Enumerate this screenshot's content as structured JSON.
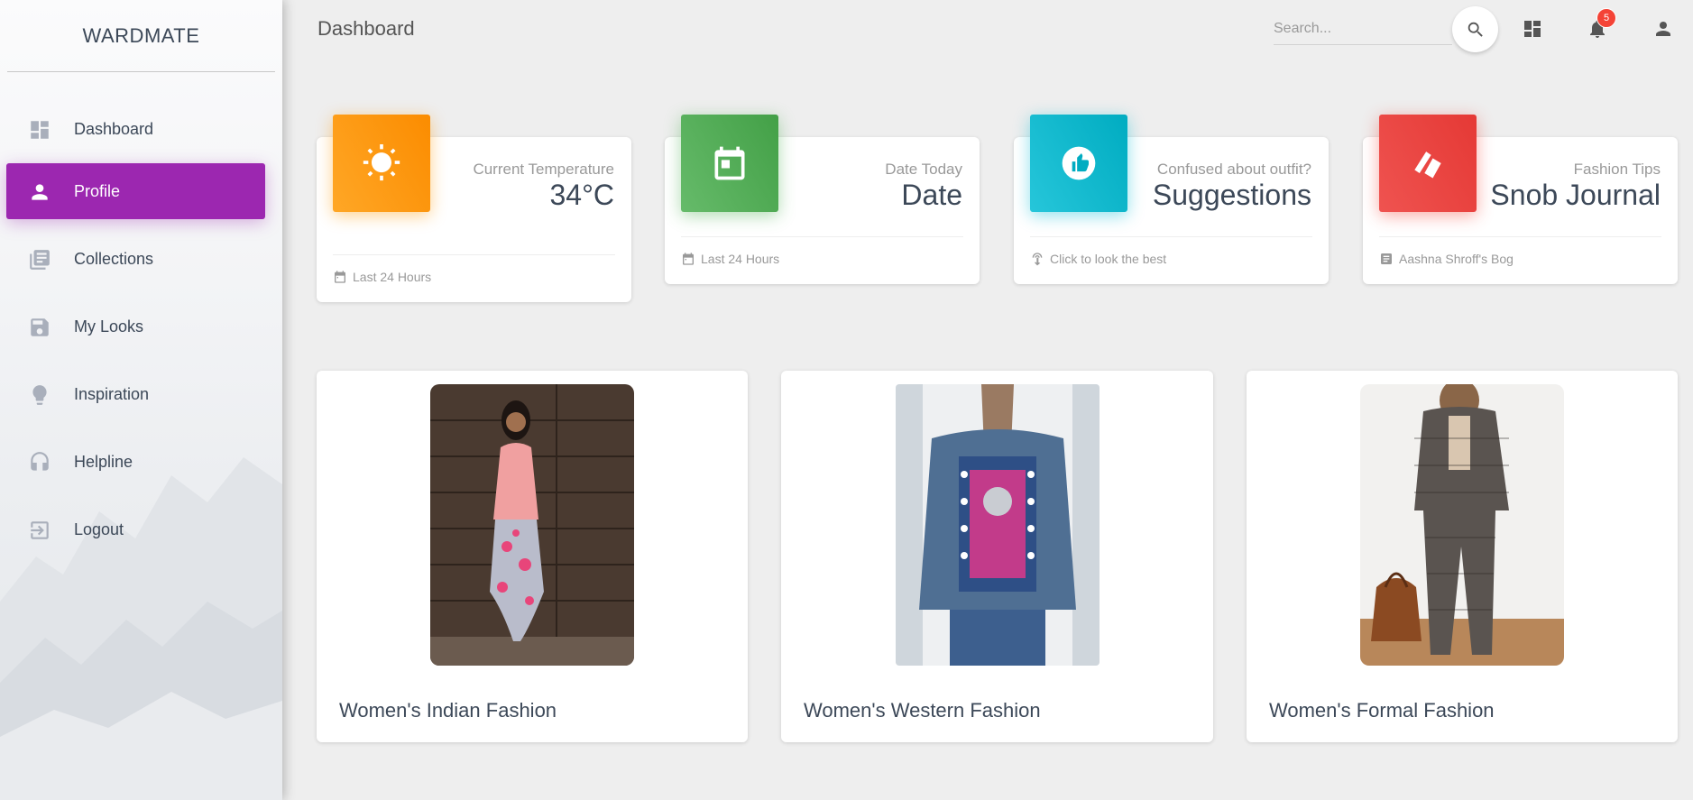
{
  "brand": "WARDMATE",
  "sidebar": {
    "items": [
      {
        "label": "Dashboard",
        "icon": "dashboard-icon"
      },
      {
        "label": "Profile",
        "icon": "person-icon",
        "active": true
      },
      {
        "label": "Collections",
        "icon": "library-icon"
      },
      {
        "label": "My Looks",
        "icon": "save-icon"
      },
      {
        "label": "Inspiration",
        "icon": "lightbulb-icon"
      },
      {
        "label": "Helpline",
        "icon": "headset-icon"
      },
      {
        "label": "Logout",
        "icon": "logout-icon"
      }
    ],
    "active_color": "#9c27b0"
  },
  "header": {
    "title": "Dashboard",
    "search_placeholder": "Search...",
    "notification_count": "5"
  },
  "stats": [
    {
      "category": "Current Temperature",
      "value": "34°C",
      "footer": "Last 24 Hours",
      "color": "#ff9800",
      "icon": "sun-icon",
      "footer_icon": "calendar-icon"
    },
    {
      "category": "Date Today",
      "value": "Date",
      "footer": "Last 24 Hours",
      "color": "#4caf50",
      "icon": "calendar-icon",
      "footer_icon": "calendar-icon"
    },
    {
      "category": "Confused about outfit?",
      "value": "Suggestions",
      "footer": "Click to look the best",
      "color": "#00bcd4",
      "icon": "thumb-up-icon",
      "footer_icon": "touch-icon"
    },
    {
      "category": "Fashion Tips",
      "value": "Snob Journal",
      "footer": "Aashna Shroff's Bog",
      "color": "#f44336",
      "icon": "swatch-icon",
      "footer_icon": "article-icon"
    }
  ],
  "fashion_cards": [
    {
      "title": "Women's Indian Fashion"
    },
    {
      "title": "Women's Western Fashion"
    },
    {
      "title": "Women's Formal Fashion"
    }
  ]
}
